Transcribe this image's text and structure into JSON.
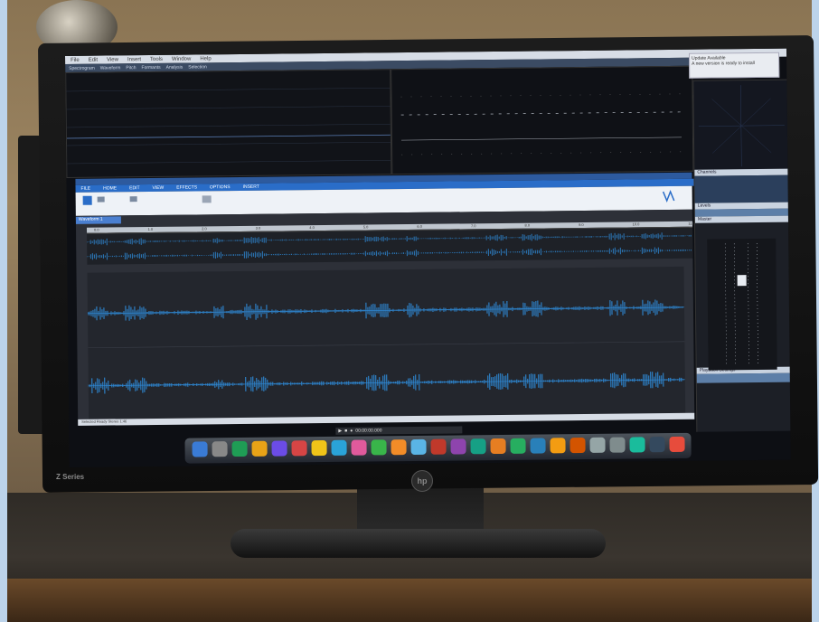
{
  "scene": {
    "brand": "hp",
    "model_text": "Z Series"
  },
  "app": {
    "menubar": [
      "File",
      "Edit",
      "View",
      "Insert",
      "Tools",
      "Window",
      "Help"
    ],
    "top_tabs": [
      "Spectrogram",
      "Waveform",
      "Pitch",
      "Formants",
      "Analysis",
      "Selection"
    ],
    "ribbon_tabs": [
      "FILE",
      "HOME",
      "EDIT",
      "VIEW",
      "EFFECTS",
      "OPTIONS",
      "INSERT"
    ],
    "document_tab": "Waveform 1",
    "overview_ruler": [
      "0.0",
      "1.0",
      "2.0",
      "3.0",
      "4.0",
      "5.0",
      "6.0",
      "7.0",
      "8.0",
      "9.0",
      "10.0",
      "11.0"
    ],
    "status_text": "Selected  Ready  Stereo  1:46",
    "transport_time": "00:00:00.000",
    "right_panels": [
      "Channels",
      "Levels",
      "Master",
      "Properties",
      "Meters",
      "Playback Settings"
    ],
    "notification": {
      "title": "Update Available",
      "body": "A new version is ready to install"
    }
  },
  "colors": {
    "waveform": "#2f8fe0",
    "ribbon": "#2a6dc8",
    "screen_bg": "#0d0f14"
  }
}
